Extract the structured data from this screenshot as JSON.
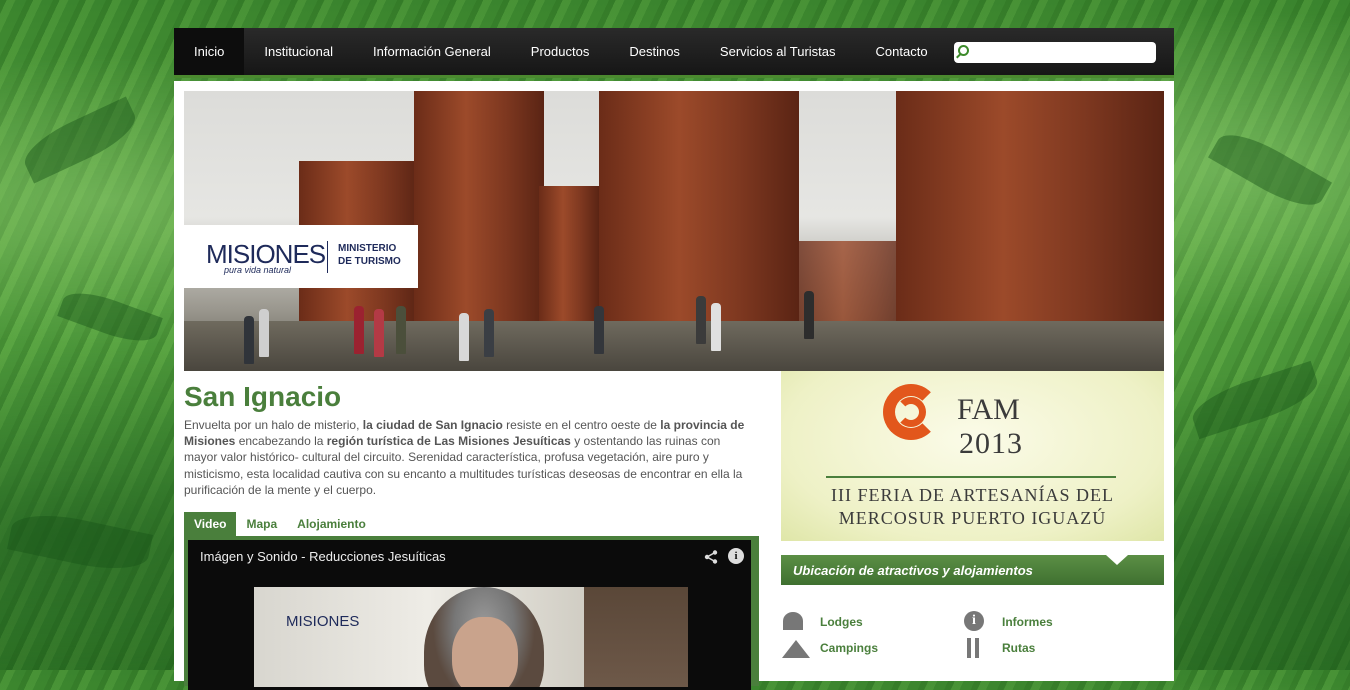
{
  "nav": {
    "items": [
      {
        "label": "Inicio",
        "active": true
      },
      {
        "label": "Institucional"
      },
      {
        "label": "Información General"
      },
      {
        "label": "Productos"
      },
      {
        "label": "Destinos"
      },
      {
        "label": "Servicios al Turistas"
      },
      {
        "label": "Contacto"
      }
    ],
    "search": {
      "value": "",
      "icon": "search-icon"
    }
  },
  "banner": {
    "logo": {
      "brand": "MISIONES",
      "tagline": "pura vida natural",
      "ministry_line1": "MINISTERIO",
      "ministry_line2": "DE TURISMO"
    }
  },
  "content": {
    "title": "San Ignacio",
    "intro": {
      "t1": "Envuelta por un halo de misterio, ",
      "b1": "la ciudad de San Ignacio",
      "t2": " resiste en el centro oeste de ",
      "b2": "la provincia de Misiones",
      "t3": " encabezando la ",
      "b3": "región turística de Las Misiones Jesuíticas",
      "t4": " y ostentando las ruinas con mayor valor histórico- cultural del circuito. Serenidad característica, profusa vegetación, aire puro y misticismo, esta localidad cautiva con su encanto a multitudes turísticas deseosas de encontrar en ella la purificación de la mente y el cuerpo."
    },
    "tabs": [
      {
        "label": "Video",
        "active": true
      },
      {
        "label": "Mapa"
      },
      {
        "label": "Alojamiento"
      }
    ],
    "video": {
      "title": "Imágen y Sonido - Reducciones Jesuíticas",
      "thumb_logo": "MISIONES"
    }
  },
  "sidebar": {
    "fam": {
      "name": "FAM",
      "year": "2013",
      "line1": "III FERIA DE ARTESANÍAS DEL",
      "line2": "MERCOSUR PUERTO IGUAZÚ"
    },
    "ubicacion_title": "Ubicación de atractivos y alojamientos",
    "links": [
      {
        "label": "Lodges",
        "icon": "lodge-icon"
      },
      {
        "label": "Informes",
        "icon": "info-icon"
      },
      {
        "label": "Campings",
        "icon": "tent-icon"
      },
      {
        "label": "Rutas",
        "icon": "route-icon"
      }
    ]
  },
  "colors": {
    "accent": "#4a7f3c",
    "nav_bg": "#1c1c1c",
    "fam_orange": "#e2571c"
  }
}
